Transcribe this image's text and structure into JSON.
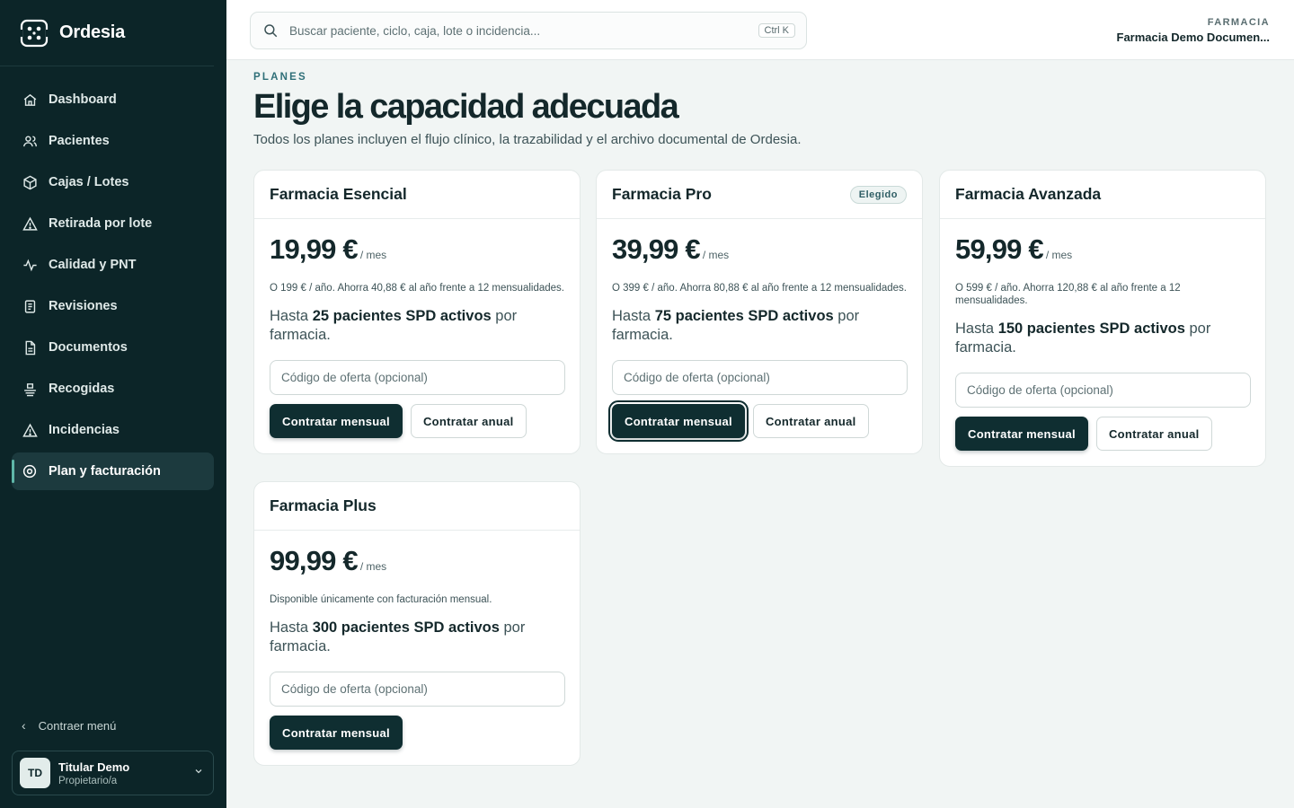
{
  "brand": {
    "name": "Ordesia"
  },
  "sidebar": {
    "items": [
      {
        "label": "Dashboard",
        "icon": "home-icon",
        "active": false
      },
      {
        "label": "Pacientes",
        "icon": "users-icon",
        "active": false
      },
      {
        "label": "Cajas / Lotes",
        "icon": "box-icon",
        "active": false
      },
      {
        "label": "Retirada por lote",
        "icon": "warning-icon",
        "active": false
      },
      {
        "label": "Calidad y PNT",
        "icon": "activity-icon",
        "active": false
      },
      {
        "label": "Revisiones",
        "icon": "clipboard-icon",
        "active": false
      },
      {
        "label": "Documentos",
        "icon": "file-icon",
        "active": false
      },
      {
        "label": "Recogidas",
        "icon": "pickup-icon",
        "active": false
      },
      {
        "label": "Incidencias",
        "icon": "alert-icon",
        "active": false
      },
      {
        "label": "Plan y facturación",
        "icon": "gear-icon",
        "active": true
      }
    ],
    "collapse_label": "Contraer menú",
    "user": {
      "initials": "TD",
      "name": "Titular Demo",
      "role": "Propietario/a"
    }
  },
  "topbar": {
    "search_placeholder": "Buscar paciente, ciclo, caja, lote o incidencia...",
    "shortcut": "Ctrl K",
    "pharmacy_label": "FARMACIA",
    "pharmacy_name": "Farmacia Demo Documen..."
  },
  "header": {
    "eyebrow": "PLANES",
    "title": "Elige la capacidad adecuada",
    "subtitle": "Todos los planes incluyen el flujo clínico, la trazabilidad y el archivo documental de Ordesia."
  },
  "plans": [
    {
      "name": "Farmacia Esencial",
      "badge": "",
      "price": "19,99 €",
      "per": "/ mes",
      "annual_note": "O 199 € / año. Ahorra 40,88 € al año frente a 12 mensualidades.",
      "cap_prefix": "Hasta ",
      "cap_strong": "25 pacientes SPD activos",
      "cap_suffix": " por farmacia.",
      "offer_placeholder": "Código de oferta (opcional)",
      "monthly_label": "Contratar mensual",
      "annual_label": "Contratar anual"
    },
    {
      "name": "Farmacia Pro",
      "badge": "Elegido",
      "price": "39,99 €",
      "per": "/ mes",
      "annual_note": "O 399 € / año. Ahorra 80,88 € al año frente a 12 mensualidades.",
      "cap_prefix": "Hasta ",
      "cap_strong": "75 pacientes SPD activos",
      "cap_suffix": " por farmacia.",
      "offer_placeholder": "Código de oferta (opcional)",
      "monthly_label": "Contratar mensual",
      "annual_label": "Contratar anual"
    },
    {
      "name": "Farmacia Avanzada",
      "badge": "",
      "price": "59,99 €",
      "per": "/ mes",
      "annual_note": "O 599 € / año. Ahorra 120,88 € al año frente a 12 mensualidades.",
      "cap_prefix": "Hasta ",
      "cap_strong": "150 pacientes SPD activos",
      "cap_suffix": " por farmacia.",
      "offer_placeholder": "Código de oferta (opcional)",
      "monthly_label": "Contratar mensual",
      "annual_label": "Contratar anual"
    },
    {
      "name": "Farmacia Plus",
      "badge": "",
      "price": "99,99 €",
      "per": "/ mes",
      "annual_note": "Disponible únicamente con facturación mensual.",
      "cap_prefix": "Hasta ",
      "cap_strong": "300 pacientes SPD activos",
      "cap_suffix": " por farmacia.",
      "offer_placeholder": "Código de oferta (opcional)",
      "monthly_label": "Contratar mensual",
      "annual_label": ""
    }
  ]
}
